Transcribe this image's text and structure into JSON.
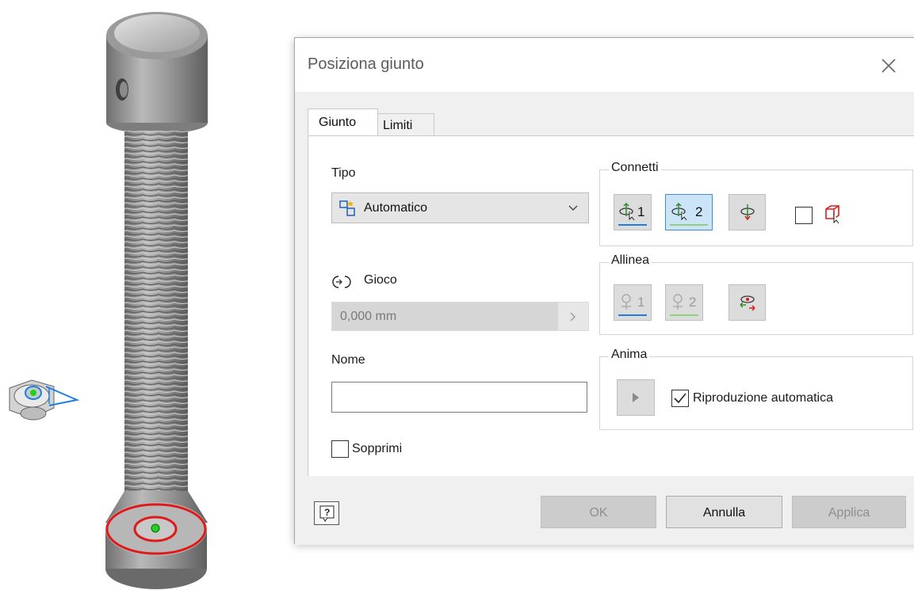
{
  "dialog": {
    "title": "Posiziona giunto",
    "tabs": [
      {
        "label": "Giunto",
        "active": true
      },
      {
        "label": "Limiti",
        "active": false
      }
    ],
    "tipo": {
      "label": "Tipo",
      "value": "Automatico"
    },
    "gioco": {
      "label": "Gioco",
      "value": "0,000 mm"
    },
    "nome": {
      "label": "Nome",
      "value": ""
    },
    "sopprimi": {
      "label": "Sopprimi",
      "checked": false
    },
    "connetti": {
      "title": "Connetti",
      "btn1": "1",
      "btn2": "2"
    },
    "allinea": {
      "title": "Allinea",
      "btn1": "1",
      "btn2": "2"
    },
    "anima": {
      "title": "Anima",
      "autoplay_label": "Riproduzione automatica",
      "autoplay_checked": true
    },
    "buttons": {
      "ok": "OK",
      "cancel": "Annulla",
      "apply": "Applica"
    }
  },
  "colors": {
    "accent_blue": "#1e7fe0",
    "accent_green": "#8fd07a",
    "highlight_red": "#e01a1a"
  },
  "icons": [
    "automatic-joint-icon",
    "chevron-down-icon",
    "gap-icon",
    "chevron-right-icon",
    "select-origin-1-icon",
    "select-origin-2-icon",
    "flip-direction-icon",
    "lock-component-icon",
    "align-1-icon",
    "align-2-icon",
    "invert-align-icon",
    "play-icon",
    "check-icon",
    "help-icon",
    "close-icon"
  ]
}
